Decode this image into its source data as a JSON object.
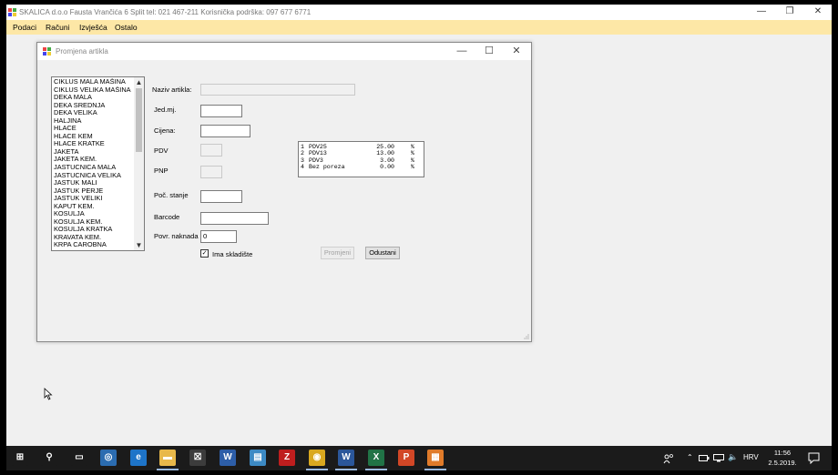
{
  "app": {
    "title": "SKALICA d.o.o Fausta Vrančića 6 Split  tel: 021 467-211  Korisnička podrška: 097 677 6771",
    "window_controls": {
      "minimize": "—",
      "maximize": "❐",
      "close": "✕"
    }
  },
  "menu": {
    "items": [
      {
        "label": "Podaci"
      },
      {
        "label": "Računi"
      },
      {
        "label": "Izvješća"
      },
      {
        "label": "Ostalo"
      }
    ]
  },
  "dialog": {
    "title": "Promjena artikla",
    "controls": {
      "minimize": "—",
      "maximize": "☐",
      "close": "✕"
    },
    "articles": [
      "CIKLUS MALA MAŠINA",
      "CIKLUS VELIKA MAŠINA",
      "DEKA MALA",
      "DEKA SREDNJA",
      "DEKA VELIKA",
      "HALJINA",
      "HLACE",
      "HLACE KEM",
      "HLACE KRATKE",
      "JAKETA",
      "JAKETA KEM.",
      "JASTUCNICA MALA",
      "JASTUCNICA VELIKA",
      "JASTUK MALI",
      "JASTUK PERJE",
      "JASTUK VELIKI",
      "KAPUT KEM.",
      "KOSULJA",
      "KOSULJA KEM.",
      "KOSULJA KRATKA",
      "KRAVATA KEM.",
      "KRPA CAROBNA"
    ],
    "scroll": {
      "up": "▲",
      "down": "▼"
    },
    "form": {
      "naziv_label": "Naziv artikla:",
      "naziv_value": "",
      "jedmj_label": "Jed.mj.",
      "jedmj_value": "",
      "cijena_label": "Cijena:",
      "cijena_value": "",
      "pdv_label": "PDV",
      "pdv_value": "",
      "pnp_label": "PNP",
      "pnp_value": "",
      "poc_label": "Poč. stanje",
      "poc_value": "",
      "barcode_label": "Barcode",
      "barcode_value": "",
      "povr_label": "Povr. naknada",
      "povr_value": "0",
      "skladiste_label": "Ima skladište",
      "skladiste_checked": true,
      "check_mark": "✓"
    },
    "vat_rates": [
      {
        "id": "1",
        "name": "PDV25",
        "rate": "25.00",
        "unit": "%"
      },
      {
        "id": "2",
        "name": "PDV13",
        "rate": "13.00",
        "unit": "%"
      },
      {
        "id": "3",
        "name": "PDV3",
        "rate": "3.00",
        "unit": "%"
      },
      {
        "id": "4",
        "name": "Bez poreza",
        "rate": "0.00",
        "unit": "%"
      }
    ],
    "buttons": {
      "save": "Promjeni",
      "cancel": "Odustani"
    }
  },
  "taskbar": {
    "apps": [
      {
        "name": "start-icon",
        "color": "#1b1b1b"
      },
      {
        "name": "search-icon",
        "color": "#1b1b1b"
      },
      {
        "name": "task-view-icon",
        "color": "#1b1b1b"
      },
      {
        "name": "teamviewer-icon",
        "color": "#2b6cb0"
      },
      {
        "name": "edge-icon",
        "color": "#1e74c8"
      },
      {
        "name": "file-explorer-icon",
        "color": "#e8b84a"
      },
      {
        "name": "store-icon",
        "color": "#3c3c3c"
      },
      {
        "name": "wordpad-icon",
        "color": "#2d5ea8"
      },
      {
        "name": "notepad-icon",
        "color": "#3d8ac4"
      },
      {
        "name": "filezilla-icon",
        "color": "#bf1e1e"
      },
      {
        "name": "chrome-icon",
        "color": "#d9a81f"
      },
      {
        "name": "word-icon",
        "color": "#2b579a"
      },
      {
        "name": "excel-icon",
        "color": "#217346"
      },
      {
        "name": "powerpoint-icon",
        "color": "#d24726"
      },
      {
        "name": "app-running-icon",
        "color": "#e07b2a"
      }
    ],
    "tray": {
      "language": "HRV",
      "time": "11:56",
      "date": "2.5.2019."
    }
  }
}
